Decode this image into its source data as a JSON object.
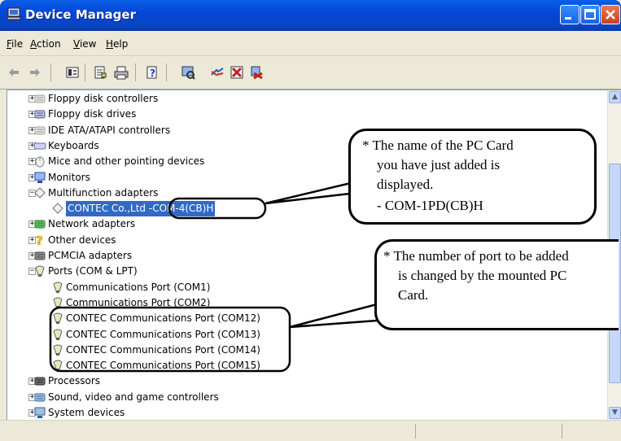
{
  "window": {
    "title": "Device Manager"
  },
  "menu": [
    {
      "label": "File",
      "accel": "F",
      "rest": "ile"
    },
    {
      "label": "Action",
      "accel": "A",
      "rest": "ction"
    },
    {
      "label": "View",
      "accel": "V",
      "rest": "iew"
    },
    {
      "label": "Help",
      "accel": "H",
      "rest": "elp"
    }
  ],
  "toolbar": {
    "icons": [
      "back-icon",
      "forward-icon",
      "properties-view-icon",
      "properties-icon",
      "print-icon",
      "help-icon",
      "scan-hardware-icon",
      "update-driver-icon",
      "disable-device-icon",
      "uninstall-device-icon"
    ]
  },
  "tree": [
    {
      "label": "Floppy disk controllers",
      "expander": "+",
      "icon": "floppy-controller-icon"
    },
    {
      "label": "Floppy disk drives",
      "expander": "+",
      "icon": "floppy-drive-icon"
    },
    {
      "label": "IDE ATA/ATAPI controllers",
      "expander": "+",
      "icon": "ide-controller-icon"
    },
    {
      "label": "Keyboards",
      "expander": "+",
      "icon": "keyboard-icon"
    },
    {
      "label": "Mice and other pointing devices",
      "expander": "+",
      "icon": "mouse-icon"
    },
    {
      "label": "Monitors",
      "expander": "+",
      "icon": "monitor-icon"
    },
    {
      "label": "Multifunction adapters",
      "expander": "-",
      "icon": "multifunction-adapter-icon"
    },
    {
      "label": "CONTEC Co.,Ltd -COM-4(CB)H",
      "expander": "",
      "icon": "multifunction-device-icon",
      "child": true,
      "selected": true
    },
    {
      "label": "Network adapters",
      "expander": "+",
      "icon": "network-adapter-icon"
    },
    {
      "label": "Other devices",
      "expander": "+",
      "icon": "other-devices-icon"
    },
    {
      "label": "PCMCIA adapters",
      "expander": "+",
      "icon": "pcmcia-icon"
    },
    {
      "label": "Ports (COM & LPT)",
      "expander": "-",
      "icon": "port-icon"
    },
    {
      "label": "Communications Port (COM1)",
      "expander": "",
      "icon": "port-icon",
      "child": true
    },
    {
      "label": "Communications Port (COM2)",
      "expander": "",
      "icon": "port-icon",
      "child": true
    },
    {
      "label": "CONTEC Communications Port (COM12)",
      "expander": "",
      "icon": "port-icon",
      "child": true
    },
    {
      "label": "CONTEC Communications Port (COM13)",
      "expander": "",
      "icon": "port-icon",
      "child": true
    },
    {
      "label": "CONTEC Communications Port (COM14)",
      "expander": "",
      "icon": "port-icon",
      "child": true
    },
    {
      "label": "CONTEC Communications Port (COM15)",
      "expander": "",
      "icon": "port-icon",
      "child": true
    },
    {
      "label": "Processors",
      "expander": "+",
      "icon": "processor-icon"
    },
    {
      "label": "Sound, video and game controllers",
      "expander": "+",
      "icon": "sound-icon"
    },
    {
      "label": "System devices",
      "expander": "+",
      "icon": "system-devices-icon"
    }
  ],
  "callouts": {
    "pc_card": {
      "lines": [
        "* The name of the PC Card",
        "you have just added is",
        "displayed.",
        "- COM-1PD(CB)H"
      ]
    },
    "ports": {
      "lines": [
        "* The number of port to be added",
        "is changed by the mounted PC",
        "Card."
      ]
    }
  },
  "colors": {
    "title_bar": "#0a50dc",
    "selection": "#316ac5",
    "pane_border": "#7f9db9"
  }
}
